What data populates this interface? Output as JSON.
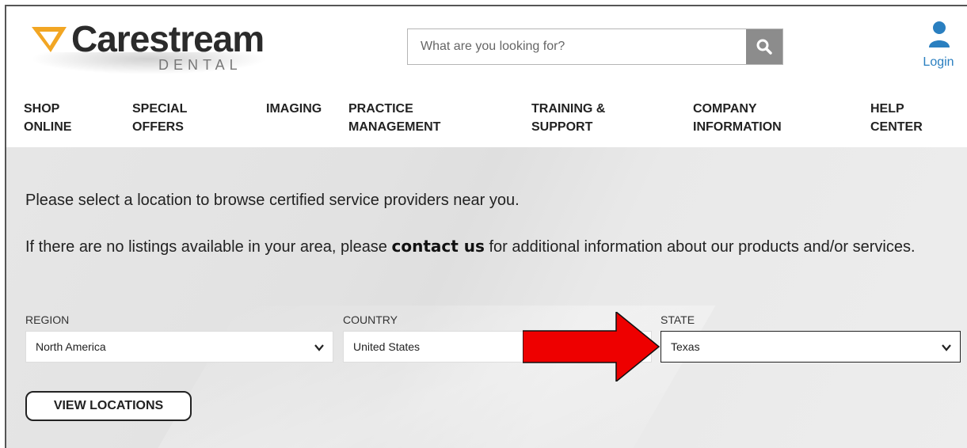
{
  "header": {
    "logo_text": "Carestream",
    "logo_sub": "DENTAL",
    "search_placeholder": "What are you looking for?",
    "login_label": "Login"
  },
  "nav": {
    "items": [
      {
        "label": "SHOP\nONLINE"
      },
      {
        "label": "SPECIAL\nOFFERS"
      },
      {
        "label": "IMAGING"
      },
      {
        "label": "PRACTICE\nMANAGEMENT"
      },
      {
        "label": "TRAINING &\nSUPPORT"
      },
      {
        "label": "COMPANY\nINFORMATION"
      },
      {
        "label": "HELP\nCENTER"
      }
    ]
  },
  "content": {
    "intro": "Please select a location to browse certified service providers near you.",
    "no_listings_before": "If there are no listings available in your area, please ",
    "contact_link": "contact us",
    "no_listings_after": " for additional information about our products and/or services.",
    "region": {
      "label": "REGION",
      "value": "North America"
    },
    "country": {
      "label": "COUNTRY",
      "value": "United States"
    },
    "state": {
      "label": "STATE",
      "value": "Texas"
    },
    "view_button": "VIEW LOCATIONS"
  },
  "colors": {
    "login_blue": "#2a7fc0",
    "search_button": "#8c8c8c",
    "arrow_red": "#ee0000",
    "logo_orange": "#f2a623"
  },
  "icons": {
    "search": "search-icon",
    "user": "user-icon",
    "chevron": "chevron-down-icon",
    "annotation": "red-arrow-icon"
  }
}
